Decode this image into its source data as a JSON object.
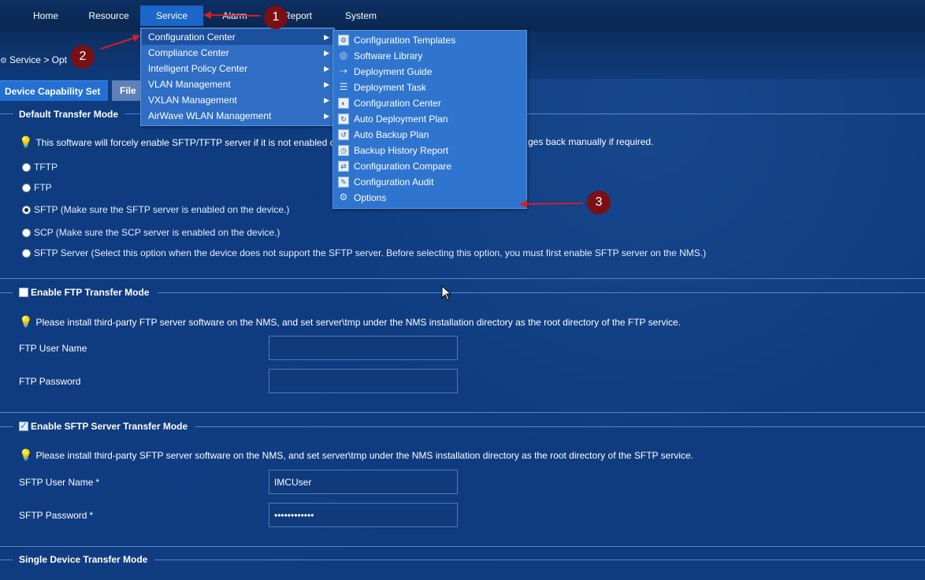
{
  "nav": {
    "items": [
      "Home",
      "Resource",
      "Service",
      "Alarm",
      "Report",
      "System"
    ],
    "active": "Service"
  },
  "breadcrumb": "Service > Opt",
  "tabs": {
    "active": "Device Capability Set",
    "inactive": "File"
  },
  "service_menu": {
    "items": [
      "Configuration Center",
      "Compliance Center",
      "Intelligent Policy Center",
      "VLAN Management",
      "VXLAN Management",
      "AirWave WLAN Management"
    ],
    "highlighted": "Configuration Center"
  },
  "config_submenu": {
    "items": [
      {
        "label": "Configuration Templates",
        "icon": "config-templates-icon"
      },
      {
        "label": "Software Library",
        "icon": "disc-icon"
      },
      {
        "label": "Deployment Guide",
        "icon": "deploy-guide-icon"
      },
      {
        "label": "Deployment Task",
        "icon": "list-icon"
      },
      {
        "label": "Configuration Center",
        "icon": "config-center-icon"
      },
      {
        "label": "Auto Deployment Plan",
        "icon": "auto-deploy-icon"
      },
      {
        "label": "Auto Backup Plan",
        "icon": "auto-backup-icon"
      },
      {
        "label": "Backup History Report",
        "icon": "backup-history-icon"
      },
      {
        "label": "Configuration Compare",
        "icon": "compare-icon"
      },
      {
        "label": "Configuration Audit",
        "icon": "audit-icon"
      },
      {
        "label": "Options",
        "icon": "gear-icon"
      }
    ]
  },
  "default_transfer": {
    "title": "Default Transfer Mode",
    "note": "This software will forcely enable SFTP/TFTP server if it is not enabled o",
    "note_tail": "ges back manually if required.",
    "options": [
      "TFTP",
      "FTP",
      "SFTP (Make sure the SFTP server is enabled on the device.)",
      "SCP (Make sure the SCP server is enabled on the device.)",
      "SFTP Server (Select this option when the device does not support the SFTP server. Before selecting this option, you must first enable SFTP server on the NMS.)"
    ],
    "selected_index": 2
  },
  "ftp_mode": {
    "title": "Enable FTP Transfer Mode",
    "checked": false,
    "note": "Please install third-party FTP server software on the NMS, and set server\\tmp under the NMS installation directory as the root directory of the FTP service.",
    "user_label": "FTP User Name",
    "password_label": "FTP Password",
    "user_value": "",
    "password_value": ""
  },
  "sftp_mode": {
    "title": "Enable SFTP Server Transfer Mode",
    "checked": true,
    "note": "Please install third-party SFTP server software on the NMS, and set server\\tmp under the NMS installation directory as the root directory of the SFTP service.",
    "user_label": "SFTP User Name",
    "password_label": "SFTP Password",
    "required_mark": "*",
    "user_value": "IMCUser",
    "password_value": "••••••••••••"
  },
  "single_device": {
    "title": "Single Device Transfer Mode"
  },
  "annotations": {
    "badges": [
      "1",
      "2",
      "3"
    ],
    "color": "#7a0f14",
    "arrow_color": "#d0202a"
  },
  "colors": {
    "background": "#0e3c7e",
    "menu": "#2f6ec4",
    "nav_active": "#1b66c9"
  }
}
